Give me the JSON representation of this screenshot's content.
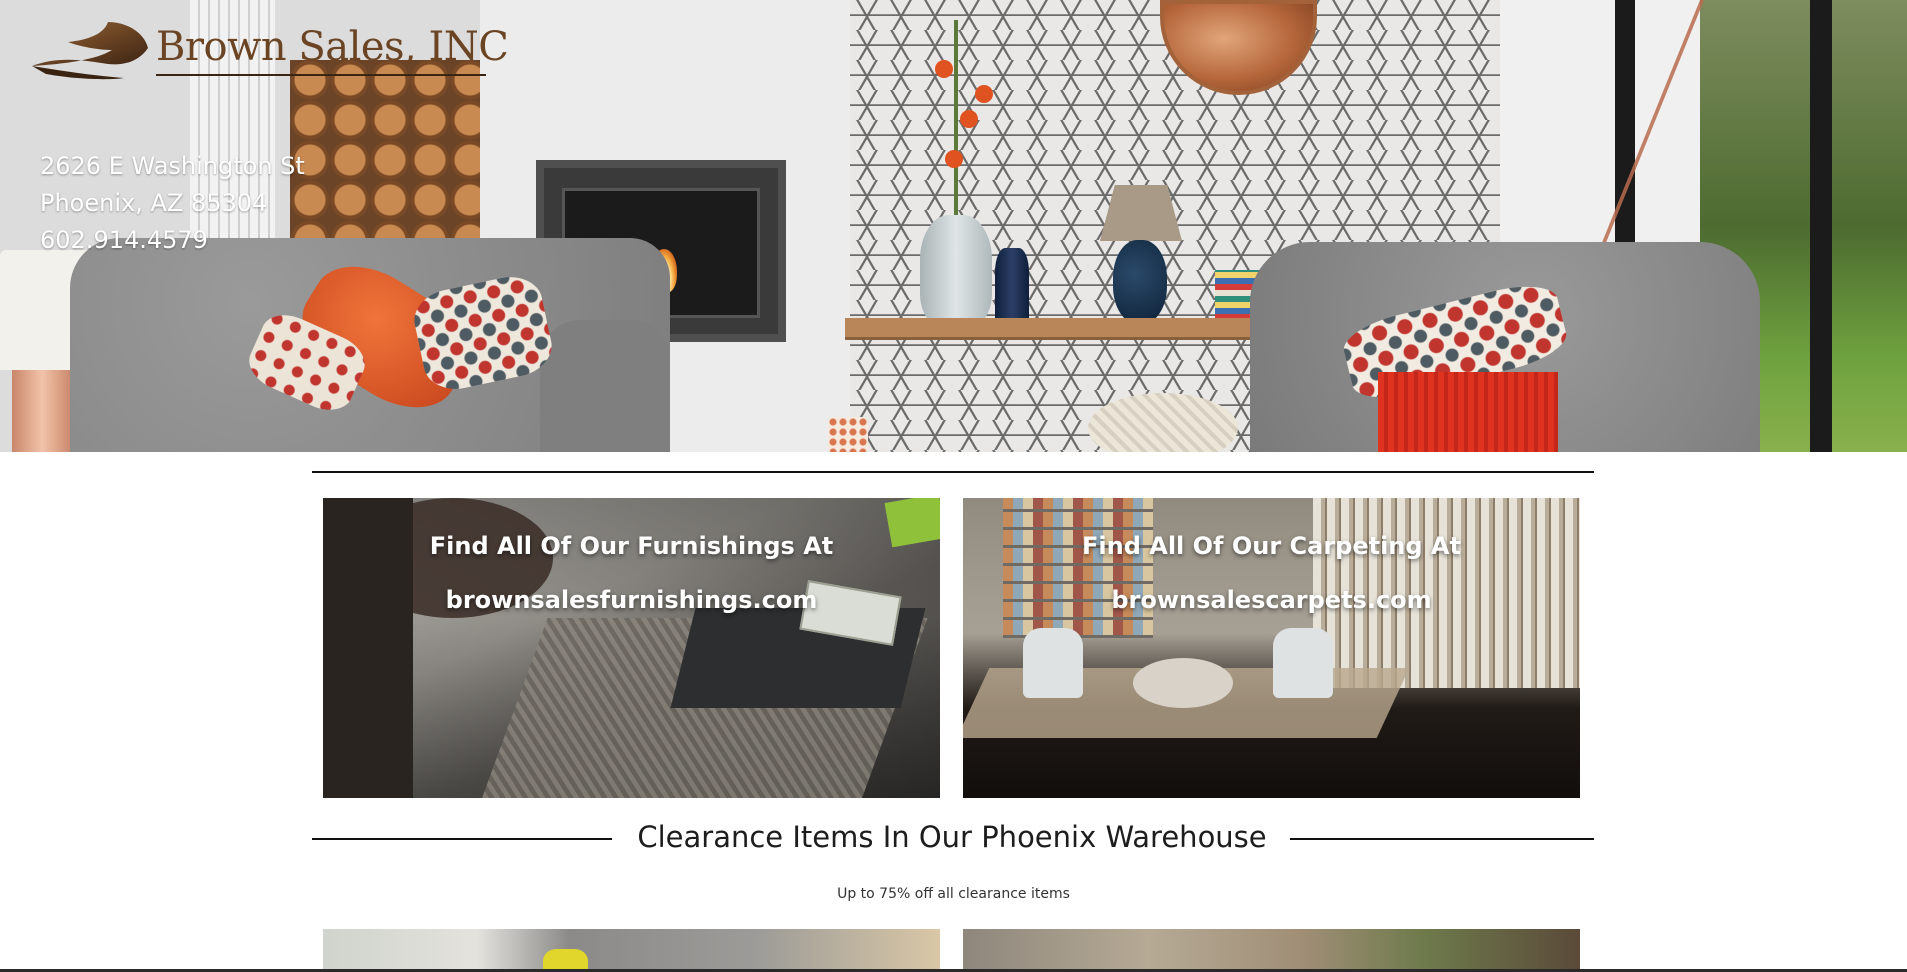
{
  "brand": {
    "name": "Brown Sales, INC",
    "logo_color": "#6b4424"
  },
  "contact": {
    "street": "2626 E Washington St",
    "city": "Phoenix, AZ 85304",
    "phone": "602.914.4579"
  },
  "promo_cards": [
    {
      "line1": "Find All Of Our Furnishings At",
      "line2": "brownsalesfurnishings.com"
    },
    {
      "line1": "Find All Of Our Carpeting At",
      "line2": "brownsalescarpets.com"
    }
  ],
  "clearance": {
    "title": "Clearance Items In Our Phoenix Warehouse",
    "subtitle": "Up to 75% off all clearance items"
  },
  "icons": {
    "logo": "swoosh-logo-icon"
  },
  "colors": {
    "text_primary": "#1d1d1d",
    "card_text": "#ffffff",
    "divider": "#111111"
  }
}
